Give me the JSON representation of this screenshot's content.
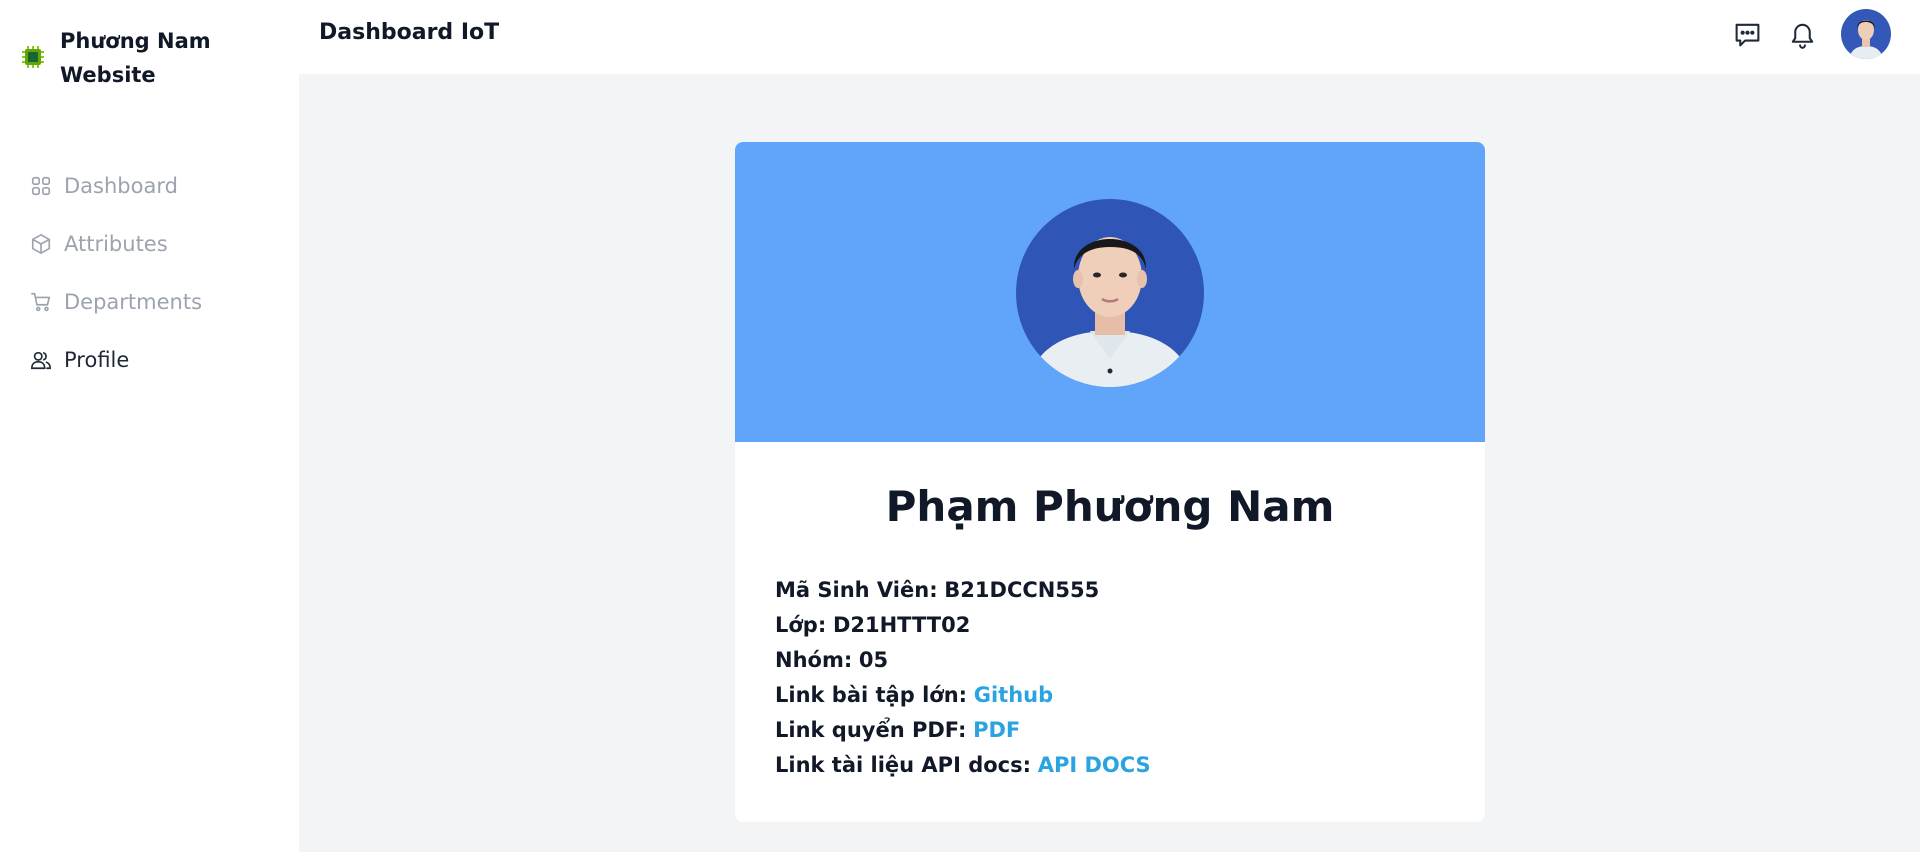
{
  "brand": {
    "name": "Phương Nam Website",
    "icon": "chip-icon"
  },
  "sidebar": {
    "items": [
      {
        "label": "Dashboard",
        "icon": "grid-icon",
        "active": false
      },
      {
        "label": "Attributes",
        "icon": "cube-icon",
        "active": false
      },
      {
        "label": "Departments",
        "icon": "cart-icon",
        "active": false
      },
      {
        "label": "Profile",
        "icon": "users-icon",
        "active": true
      }
    ]
  },
  "header": {
    "title": "Dashboard IoT",
    "icons": [
      "message-icon",
      "bell-icon"
    ]
  },
  "profile": {
    "name": "Phạm Phương Nam",
    "student_id_label": "Mã Sinh Viên:",
    "student_id": "B21DCCN555",
    "class_label": "Lớp:",
    "class": "D21HTTT02",
    "group_label": "Nhóm:",
    "group": "05",
    "project_link_label": "Link bài tập lớn:",
    "project_link_text": "Github",
    "pdf_link_label": "Link quyển PDF:",
    "pdf_link_text": "PDF",
    "api_link_label": "Link tài liệu API docs:",
    "api_link_text": "API DOCS"
  },
  "colors": {
    "banner": "#60a5fa",
    "link": "#2ba3e0",
    "background": "#f3f4f6",
    "nav_inactive": "#9ca3af"
  }
}
